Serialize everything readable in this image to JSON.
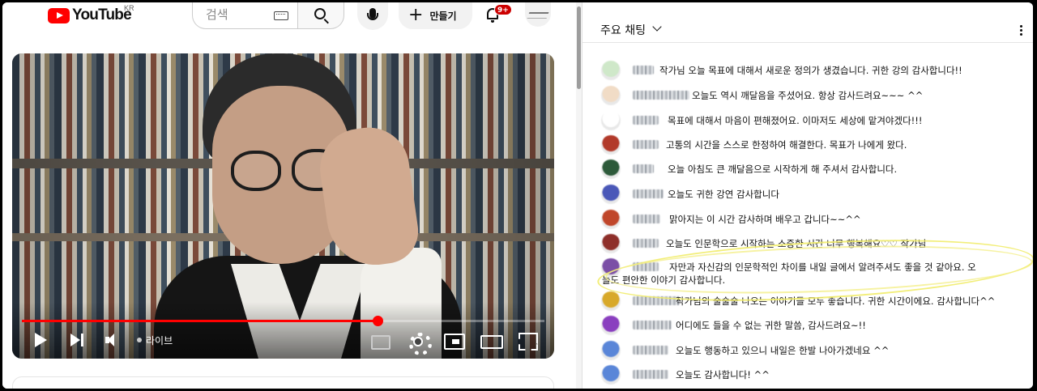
{
  "header": {
    "logo_text": "YouTube",
    "country_code": "KR",
    "search_placeholder": "검색",
    "create_label": "만들기",
    "notification_count": "9+"
  },
  "player": {
    "live_label": "라이브",
    "progress_fraction": 0.68
  },
  "chat": {
    "title": "주요 채팅",
    "messages": [
      {
        "text": "작가님 오늘 목표에 대해서 새로운 정의가 생겼습니다. 귀한 강의 감사합니다!!",
        "avatar_color": "#cfe8c9"
      },
      {
        "text": "오늘도 역시 깨달음을 주셨어요. 항상 감사드려요~~~ ^^",
        "avatar_color": "#f1dcc6"
      },
      {
        "text": "목표에 대해서 마음이 편해졌어요. 이마저도 세상에 맡겨야겠다!!!",
        "avatar_color": "#ffffff"
      },
      {
        "text": "고통의 시간을 스스로 한정하여 해결한다. 목표가 나에게 왔다.",
        "avatar_color": "#b23a2a"
      },
      {
        "text": "오늘 아침도 큰 깨달음으로 시작하게 해 주셔서 감사합니다.",
        "avatar_color": "#2d5a3a"
      },
      {
        "text": "오늘도 귀한 강연 감사합니다",
        "avatar_color": "#4a58b8"
      },
      {
        "text": "맑아지는 이 시간 감사하며 배우고 갑니다~~^^",
        "avatar_color": "#c0462a"
      },
      {
        "text": "오늘도 인문학으로 시작하는 소중한 시간 너무 행복해요♡♡ 작가님",
        "avatar_color": "#8e2f2a"
      },
      {
        "text": "자만과 자신감의 인문학적인 차이를 내일 글에서 알려주셔도 좋을 것 같아요. 오늘도 편안한 이야기 감사합니다.",
        "avatar_color": "#7b4fa6"
      },
      {
        "text": "작가님의 술술술 나오는 이야기들 모두 좋습니다. 귀한 시간이에요. 감사합니다^^",
        "avatar_color": "#d8a92a"
      },
      {
        "text": "어디에도 들을 수 없는 귀한 말씀, 감사드려요~!!",
        "avatar_color": "#8a3fbf"
      },
      {
        "text": "오늘도 행동하고 있으니 내일은 한발 나아가겠네요 ^^",
        "avatar_color": "#5a86d8"
      },
      {
        "text": "오늘도 감사합니다! ^^",
        "avatar_color": "#5a86d8"
      }
    ]
  }
}
